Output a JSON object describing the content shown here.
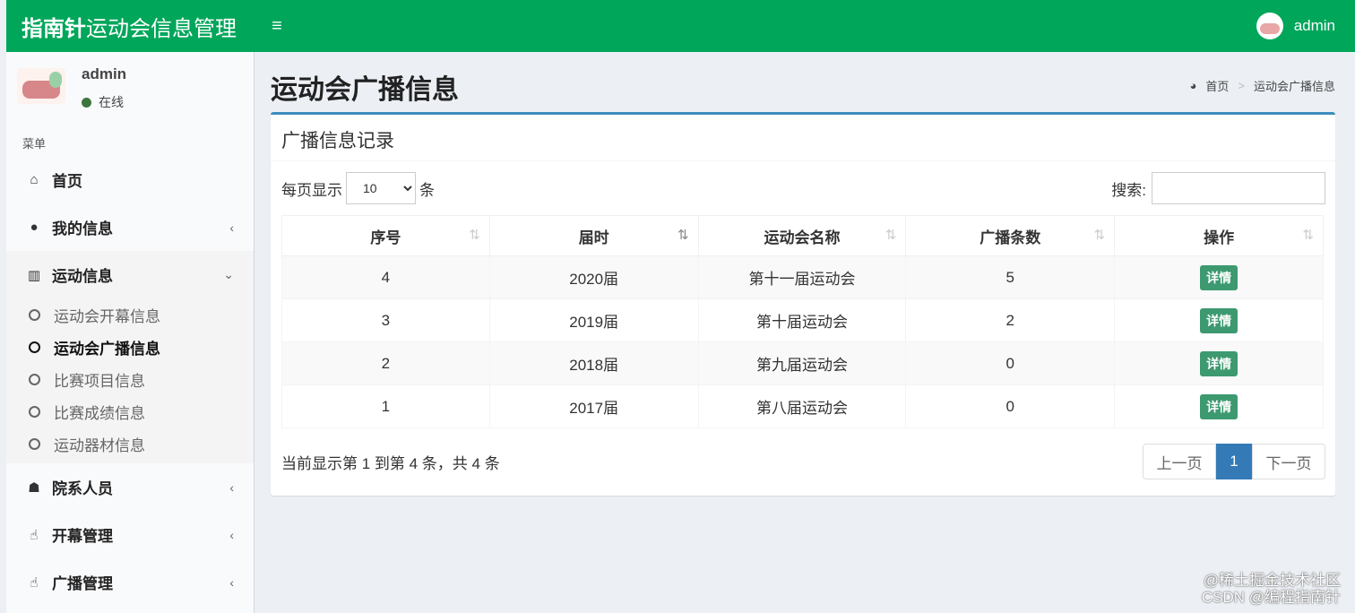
{
  "header": {
    "brand_bold": "指南针",
    "brand_rest": "运动会信息管理",
    "menu_toggle": "≡",
    "user": "admin"
  },
  "sidebar": {
    "user_name": "admin",
    "status": "在线",
    "menu_header": "菜单",
    "items": [
      {
        "label": "首页",
        "icon": "home-icon",
        "has_chevron": false
      },
      {
        "label": "我的信息",
        "icon": "user-icon",
        "chevron": "‹"
      },
      {
        "label": "运动信息",
        "icon": "bar-chart-icon",
        "chevron": "⌄"
      },
      {
        "label": "院系人员",
        "icon": "users-icon",
        "chevron": "‹"
      },
      {
        "label": "开幕管理",
        "icon": "thumbs-up-icon",
        "chevron": "‹"
      },
      {
        "label": "广播管理",
        "icon": "thumbs-up-icon",
        "chevron": "‹"
      }
    ],
    "submenu": [
      {
        "label": "运动会开幕信息"
      },
      {
        "label": "运动会广播信息"
      },
      {
        "label": "比赛项目信息"
      },
      {
        "label": "比赛成绩信息"
      },
      {
        "label": "运动器材信息"
      }
    ]
  },
  "main": {
    "page_title": "运动会广播信息",
    "breadcrumb": {
      "home": "首页",
      "separator": ">",
      "current": "运动会广播信息"
    },
    "box_title": "广播信息记录",
    "length": {
      "prefix": "每页显示",
      "value": "10",
      "suffix": "条"
    },
    "search": {
      "label": "搜索:",
      "value": ""
    },
    "table": {
      "columns": [
        "序号",
        "届时",
        "运动会名称",
        "广播条数",
        "操作"
      ],
      "rows": [
        {
          "id": "4",
          "year": "2020届",
          "name": "第十一届运动会",
          "count": "5",
          "action": "详情"
        },
        {
          "id": "3",
          "year": "2019届",
          "name": "第十届运动会",
          "count": "2",
          "action": "详情"
        },
        {
          "id": "2",
          "year": "2018届",
          "name": "第九届运动会",
          "count": "0",
          "action": "详情"
        },
        {
          "id": "1",
          "year": "2017届",
          "name": "第八届运动会",
          "count": "0",
          "action": "详情"
        }
      ]
    },
    "info": "当前显示第 1 到第 4 条，共 4 条",
    "pagination": {
      "prev": "上一页",
      "current": "1",
      "next": "下一页"
    }
  },
  "watermark": {
    "line1": "@稀土掘金技术社区",
    "line2": "CSDN @编程指南针"
  },
  "colors": {
    "header": "#00a65a",
    "box_accent": "#3c8dbc",
    "detail_button": "#3d9970",
    "active_page": "#337ab7"
  }
}
